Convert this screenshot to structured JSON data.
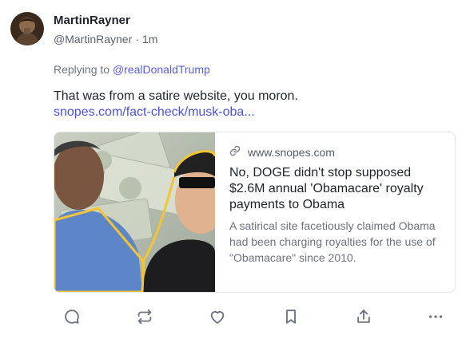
{
  "author": {
    "display_name": "MartinRayner",
    "handle": "@MartinRayner",
    "time": "1m"
  },
  "reply": {
    "prefix": "Replying to",
    "target": "@realDonaldTrump"
  },
  "post": {
    "text": "That was from a satire website, you moron.",
    "link_text": "snopes.com/fact-check/musk-oba..."
  },
  "link_card": {
    "domain": "www.snopes.com",
    "title": "No, DOGE didn't stop supposed $2.6M annual 'Obamacare' royalty payments to Obama",
    "description": "A satirical site facetiously claimed Obama had been charging royalties for the use of \"Obamacare\" since 2010."
  },
  "actions": [
    {
      "icon": "reply-icon"
    },
    {
      "icon": "repost-icon"
    },
    {
      "icon": "heart-icon"
    },
    {
      "icon": "bookmark-icon"
    },
    {
      "icon": "share-icon"
    },
    {
      "icon": "more-icon"
    }
  ],
  "colors": {
    "link": "#4a53d8",
    "mention": "#5a5ce0",
    "muted": "#6b7280",
    "icon": "#6b7280"
  }
}
